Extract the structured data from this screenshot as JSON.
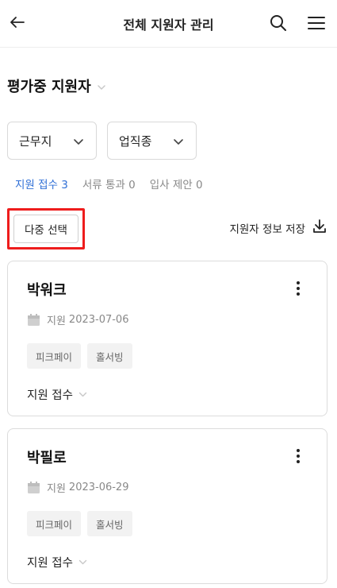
{
  "header": {
    "title": "전체 지원자 관리",
    "back_icon": "arrow-left-icon",
    "search_icon": "search-icon",
    "menu_icon": "hamburger-menu-icon"
  },
  "section": {
    "title": "평가중 지원자"
  },
  "filters": [
    {
      "label": "근무지"
    },
    {
      "label": "업직종"
    }
  ],
  "tabs": [
    {
      "label": "지원 접수",
      "count": "3",
      "active": true
    },
    {
      "label": "서류 통과",
      "count": "0",
      "active": false
    },
    {
      "label": "입사 제안",
      "count": "0",
      "active": false
    }
  ],
  "actions": {
    "multi_select": "다중 선택",
    "save_info": "지원자 정보 저장"
  },
  "colors": {
    "accent": "#2f6fd6",
    "highlight": "#ee1c1c"
  },
  "applicants": [
    {
      "name": "박워크",
      "date_prefix": "지원",
      "date": "2023-07-06",
      "tags": [
        "피크페이",
        "홀서빙"
      ],
      "status": "지원 접수"
    },
    {
      "name": "박필로",
      "date_prefix": "지원",
      "date": "2023-06-29",
      "tags": [
        "피크페이",
        "홀서빙"
      ],
      "status": "지원 접수"
    }
  ]
}
